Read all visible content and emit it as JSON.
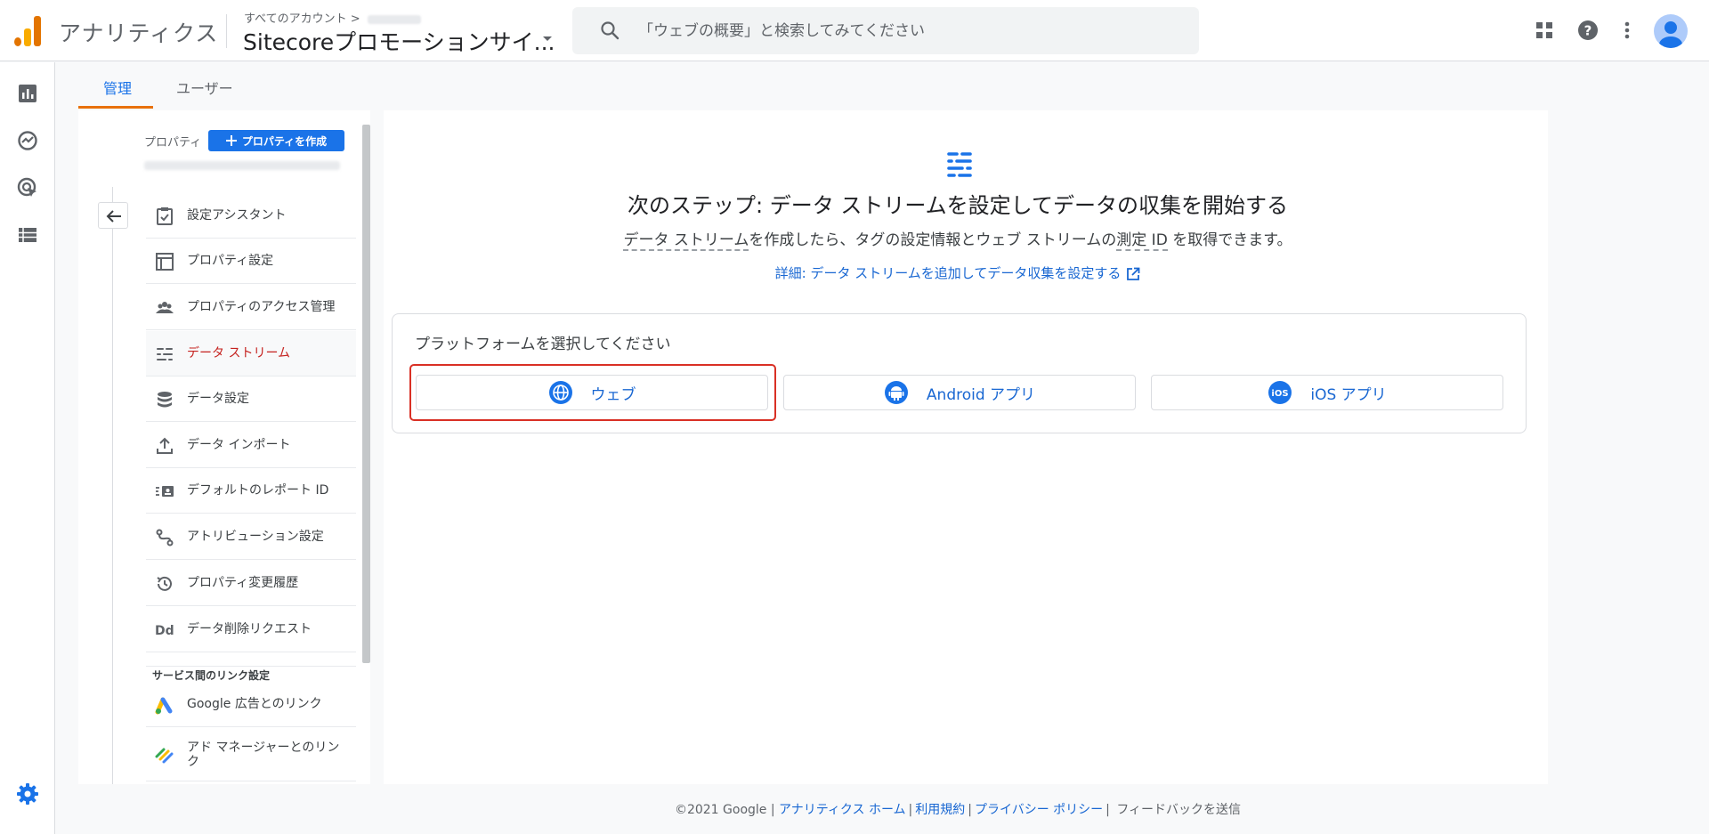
{
  "header": {
    "app_name": "アナリティクス",
    "breadcrumb": "すべてのアカウント >",
    "property_title": "Sitecoreプロモーションサイ...",
    "search_placeholder": "「ウェブの概要」と検索してみてください"
  },
  "tabs": [
    {
      "label": "管理"
    },
    {
      "label": "ユーザー"
    }
  ],
  "property_panel": {
    "label": "プロパティ",
    "create_label": "プロパティを作成",
    "items": [
      {
        "label": "設定アシスタント"
      },
      {
        "label": "プロパティ設定"
      },
      {
        "label": "プロパティのアクセス管理"
      },
      {
        "label": "データ ストリーム"
      },
      {
        "label": "データ設定"
      },
      {
        "label": "データ インポート"
      },
      {
        "label": "デフォルトのレポート ID"
      },
      {
        "label": "アトリビューション設定"
      },
      {
        "label": "プロパティ変更履歴"
      },
      {
        "label": "データ削除リクエスト"
      }
    ],
    "section_label": "サービス間のリンク設定",
    "link_items": [
      {
        "label": "Google 広告とのリンク"
      },
      {
        "label": "アド マネージャーとのリンク"
      }
    ]
  },
  "main": {
    "title": "次のステップ: データ ストリームを設定してデータの収集を開始する",
    "desc_part1": "データ ストリーム",
    "desc_part2": "を作成したら、タグの設定情報とウェブ ストリームの",
    "desc_part3": "測定 ID",
    "desc_part4": " を取得できます。",
    "learn_link": "詳細: データ ストリームを追加してデータ収集を設定する",
    "platform_label": "プラットフォームを選択してください",
    "platforms": [
      {
        "label": "ウェブ"
      },
      {
        "label": "Android アプリ"
      },
      {
        "label": "iOS アプリ"
      }
    ]
  },
  "footer": {
    "copyright": "©2021 Google |",
    "home": "アナリティクス ホーム",
    "terms": "利用規約",
    "privacy": "プライバシー ポリシー",
    "feedback": "フィードバックを送信"
  },
  "colors": {
    "accent": "#1a73e8",
    "active_item": "#c5221f",
    "tab_underline": "#e8710a",
    "highlight": "#d93025"
  }
}
